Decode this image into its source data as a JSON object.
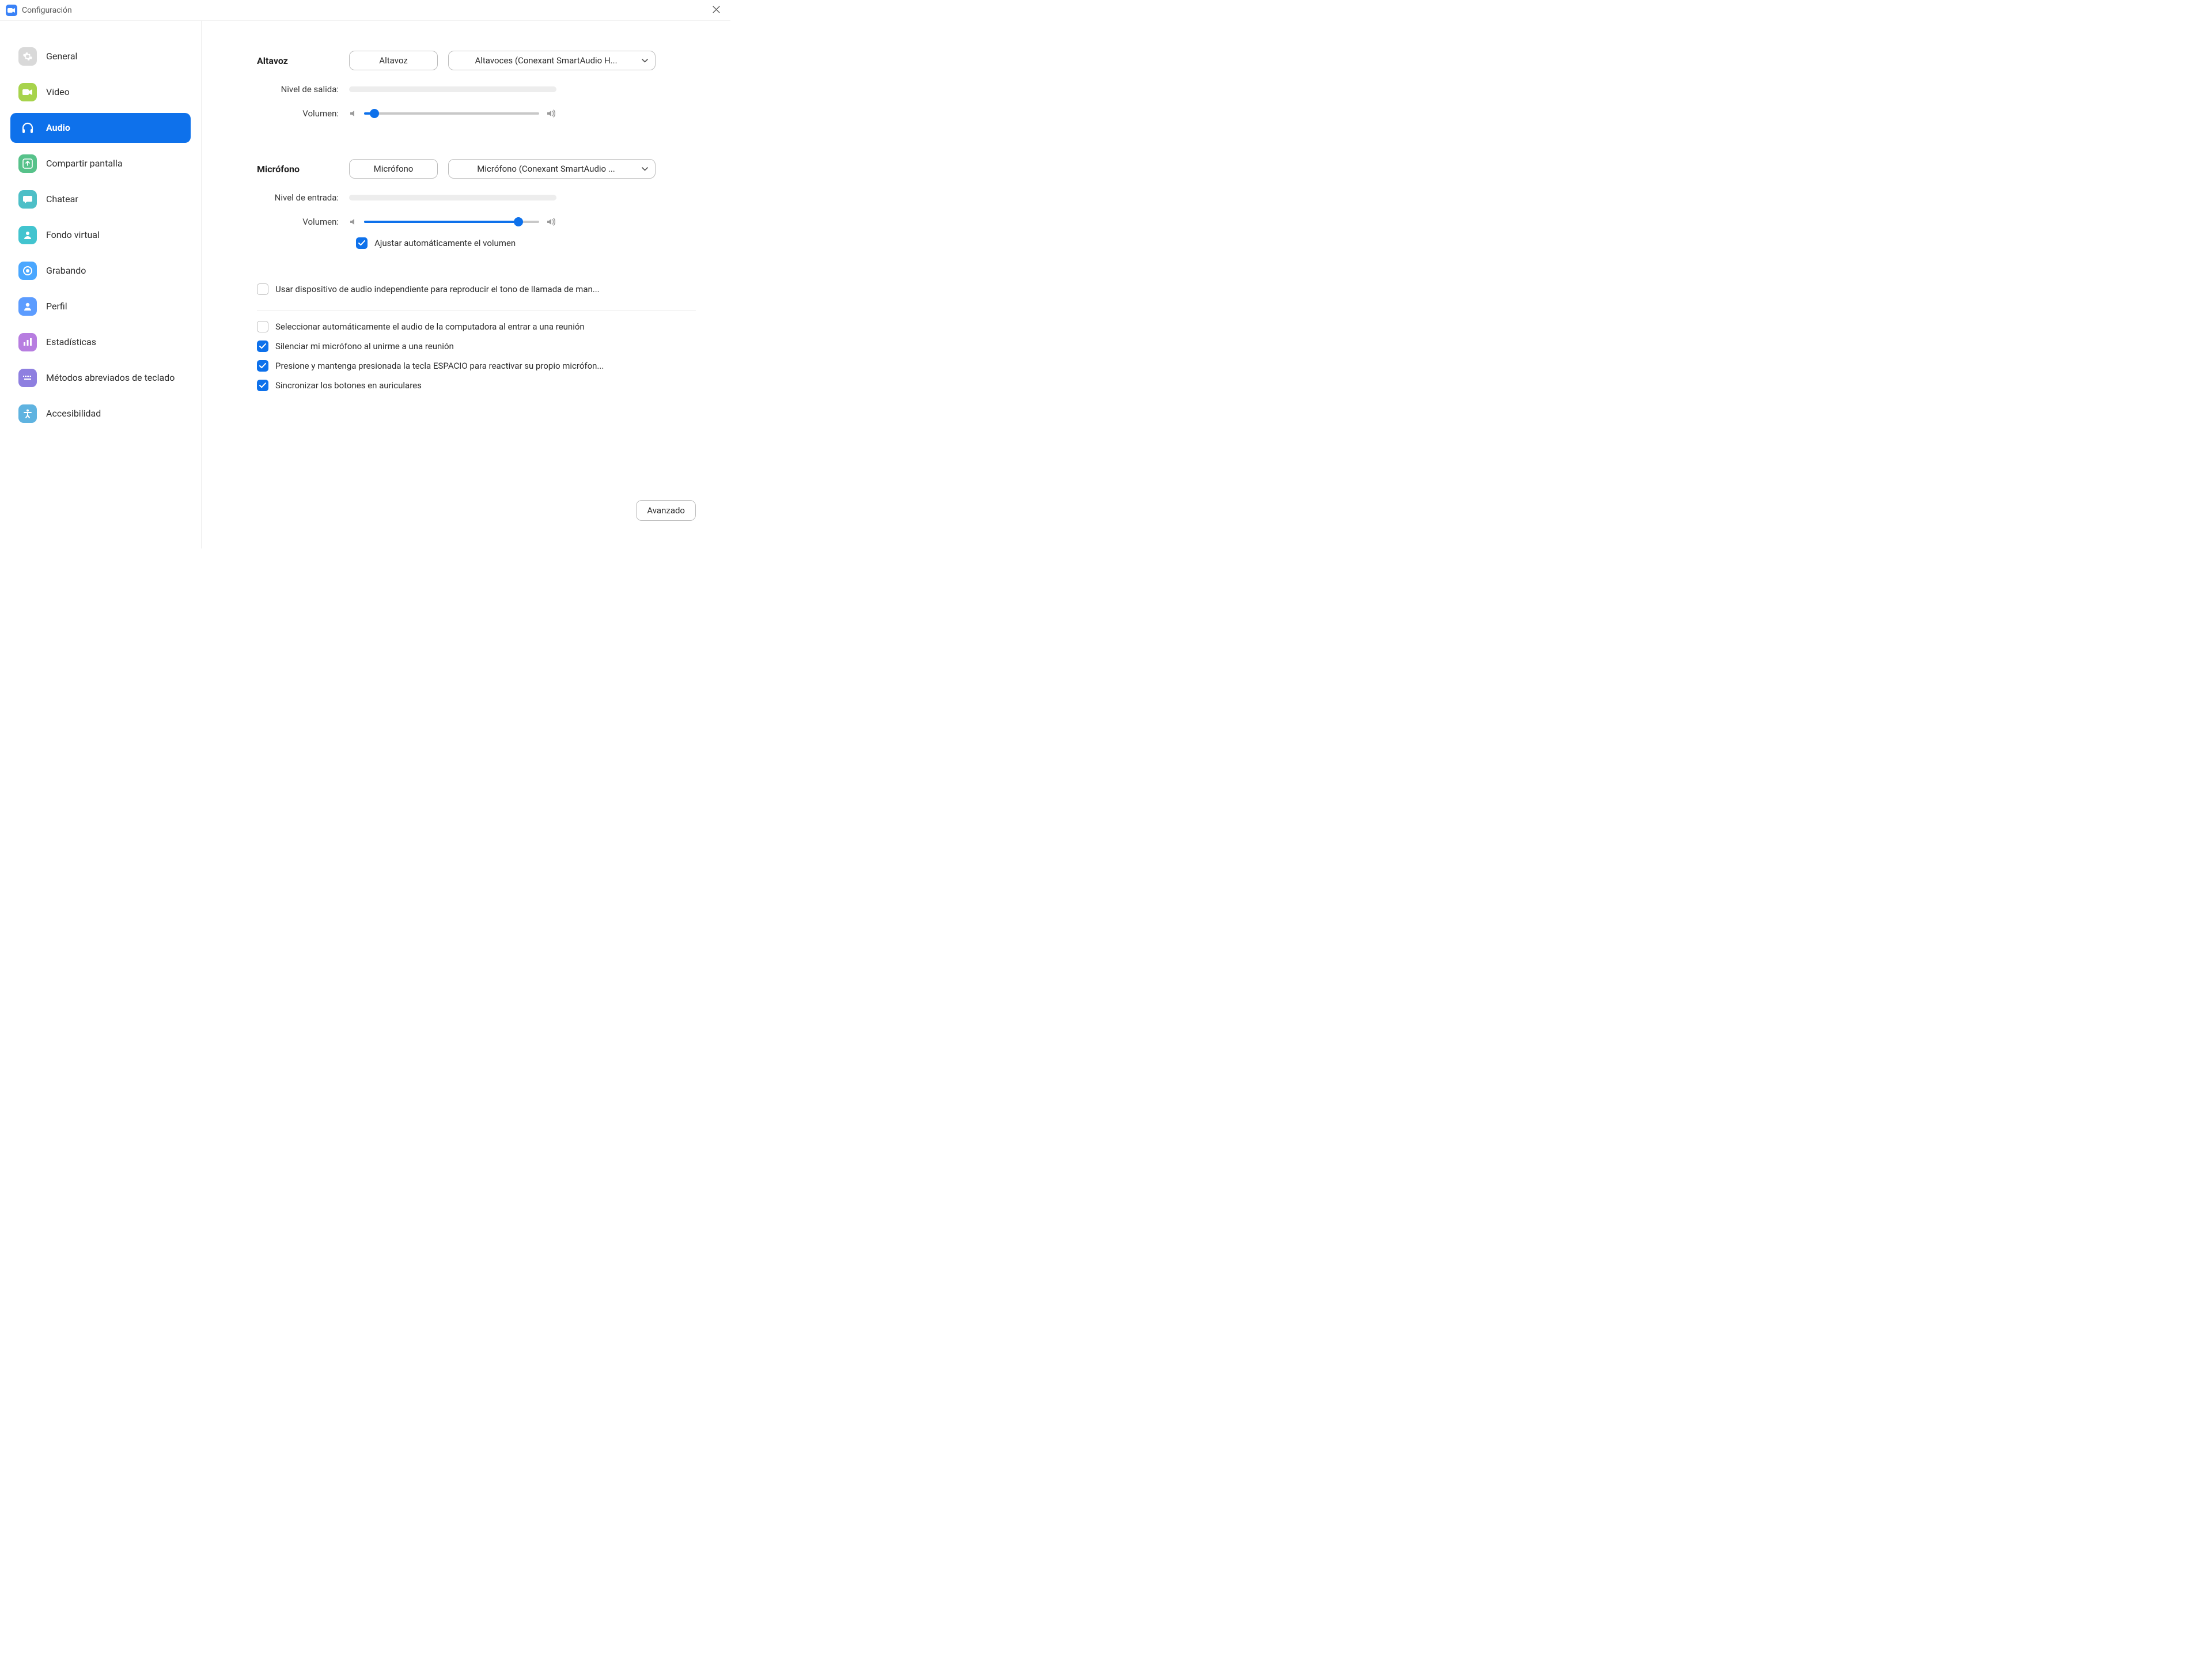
{
  "window": {
    "title": "Configuración"
  },
  "sidebar": {
    "items": [
      {
        "label": "General"
      },
      {
        "label": "Video"
      },
      {
        "label": "Audio"
      },
      {
        "label": "Compartir pantalla"
      },
      {
        "label": "Chatear"
      },
      {
        "label": "Fondo virtual"
      },
      {
        "label": "Grabando"
      },
      {
        "label": "Perfil"
      },
      {
        "label": "Estadísticas"
      },
      {
        "label": "Métodos abreviados de teclado"
      },
      {
        "label": "Accesibilidad"
      }
    ],
    "active_index": 2
  },
  "speaker": {
    "heading": "Altavoz",
    "test_button": "Altavoz",
    "device_selected": "Altavoces (Conexant SmartAudio H...",
    "output_level_label": "Nivel de salida:",
    "volume_label": "Volumen:",
    "volume_pct": 6
  },
  "microphone": {
    "heading": "Micrófono",
    "test_button": "Micrófono",
    "device_selected": "Micrófono (Conexant SmartAudio ...",
    "input_level_label": "Nivel de entrada:",
    "volume_label": "Volumen:",
    "volume_pct": 88,
    "auto_adjust": {
      "label": "Ajustar automáticamente el volumen",
      "checked": true
    }
  },
  "options": {
    "separate_ringtone": {
      "label": "Usar dispositivo de audio independiente para reproducir el tono de llamada de man...",
      "checked": false
    },
    "auto_join_audio": {
      "label": "Seleccionar automáticamente el audio de la computadora al entrar a una reunión",
      "checked": false
    },
    "mute_on_join": {
      "label": "Silenciar mi micrófono al unirme a una reunión",
      "checked": true
    },
    "push_to_talk": {
      "label": "Presione y mantenga presionada la tecla ESPACIO para reactivar su propio micrófon...",
      "checked": true
    },
    "sync_headset": {
      "label": "Sincronizar los botones en auriculares",
      "checked": true
    }
  },
  "footer": {
    "advanced": "Avanzado"
  }
}
